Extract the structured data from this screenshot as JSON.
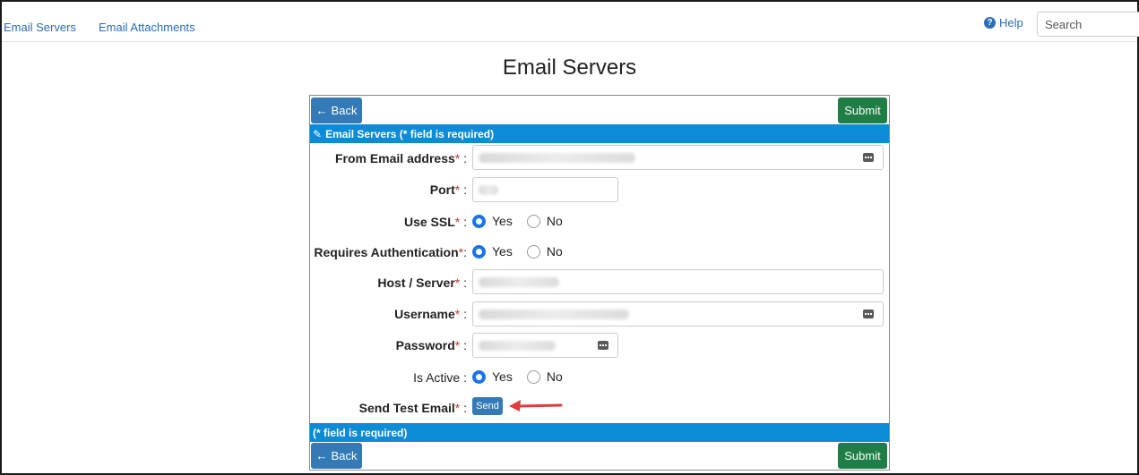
{
  "nav": {
    "links": [
      "Email Servers",
      "Email Attachments"
    ],
    "help_label": "Help",
    "search_placeholder": "Search"
  },
  "page": {
    "title": "Email Servers"
  },
  "toolbar": {
    "back_label": "Back",
    "submit_label": "Submit"
  },
  "form": {
    "header": "Email Servers (* field is required)",
    "footer": "(* field is required)",
    "required_mark": "*",
    "separator": ":",
    "fields": {
      "from_email": {
        "label": "From Email address"
      },
      "port": {
        "label": "Port"
      },
      "use_ssl": {
        "label": "Use SSL",
        "options": [
          "Yes",
          "No"
        ],
        "selected": "Yes"
      },
      "requires_auth": {
        "label": "Requires Authentication",
        "options": [
          "Yes",
          "No"
        ],
        "selected": "Yes"
      },
      "host": {
        "label": "Host / Server"
      },
      "username": {
        "label": "Username"
      },
      "password": {
        "label": "Password"
      },
      "is_active": {
        "label": "Is Active",
        "options": [
          "Yes",
          "No"
        ],
        "selected": "Yes"
      },
      "send_test": {
        "label": "Send Test Email",
        "button_label": "Send"
      }
    }
  },
  "colors": {
    "primary_blue": "#337ab7",
    "submit_green": "#1e7e45",
    "band_blue": "#0c8bd6",
    "required_red": "#c0392b",
    "annotation_arrow": "#e03a3a"
  }
}
